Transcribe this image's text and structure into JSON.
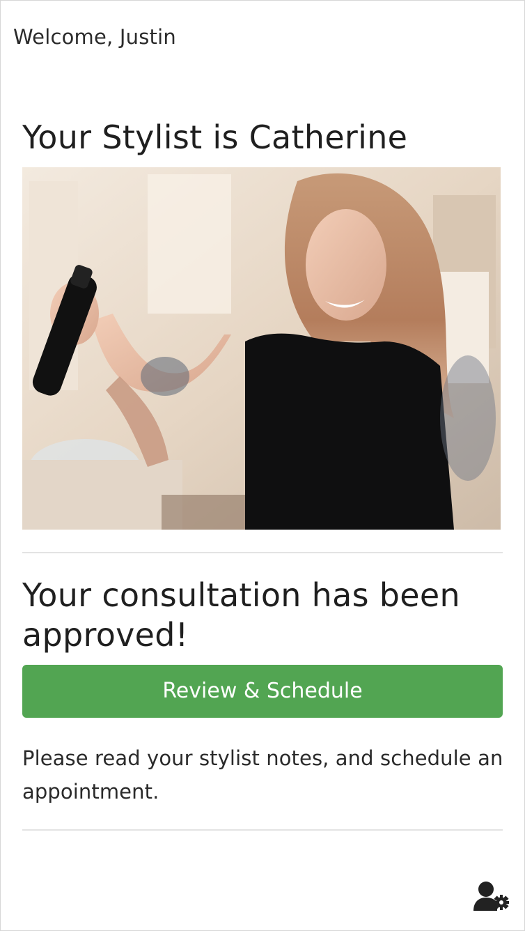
{
  "header": {
    "welcome_text": "Welcome, Justin"
  },
  "stylist": {
    "heading": "Your Stylist is Catherine",
    "photo_icon": "stylist-photo"
  },
  "consultation": {
    "status_heading": "Your consultation has been approved!",
    "cta_label": "Review & Schedule",
    "note": "Please read your stylist notes, and schedule an appointment.",
    "cta_color": "#52a552"
  },
  "footer": {
    "settings_icon": "user-settings-icon"
  }
}
